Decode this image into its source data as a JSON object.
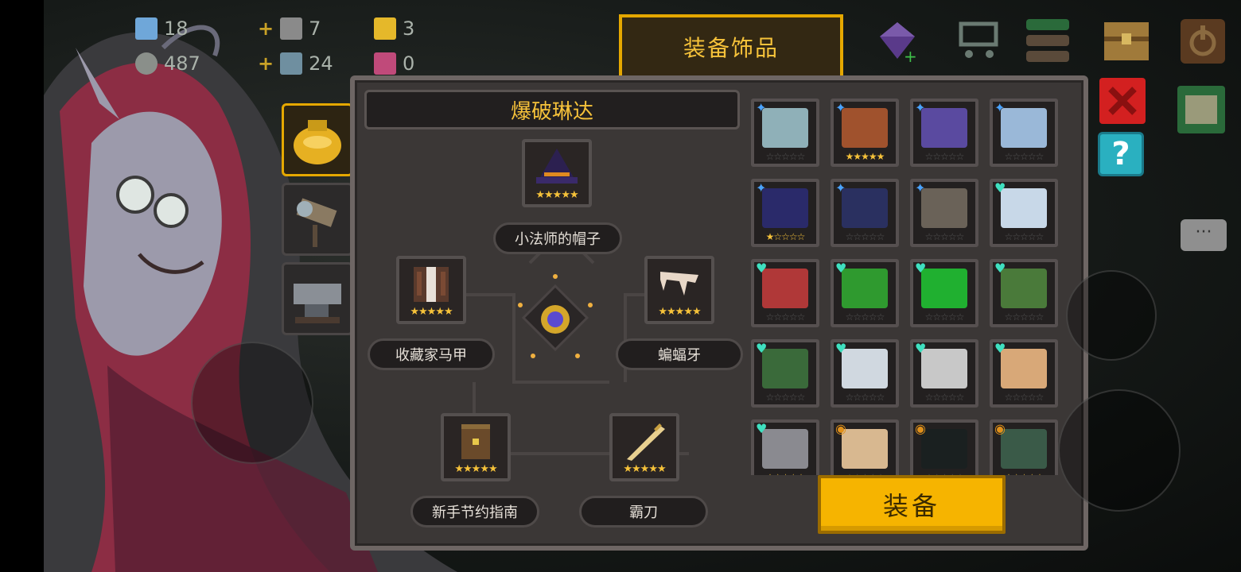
{
  "resources": [
    {
      "value": "18",
      "icon": "gem-icon",
      "color": "#6fa7d9"
    },
    {
      "value": "487",
      "icon": "coin-icon",
      "color": "#c9c9c9"
    },
    {
      "value": "7",
      "icon": "material-box-icon",
      "color": "#8a8a8a"
    },
    {
      "value": "24",
      "icon": "material-box-icon",
      "color": "#6f8fa0"
    },
    {
      "value": "3",
      "icon": "gold-key-icon",
      "color": "#e5b82a"
    },
    {
      "value": "0",
      "icon": "seed-icon",
      "color": "#c04a7a"
    }
  ],
  "title_tab": "装备饰品",
  "hero_name": "爆破琳达",
  "slots": [
    {
      "label": "小法师的帽子",
      "stars": "★★★★★",
      "icon": "wizard-hat-icon",
      "color": "#2c2050"
    },
    {
      "label": "收藏家马甲",
      "stars": "★★★★★",
      "icon": "vest-icon",
      "color": "#5a3a2c"
    },
    {
      "label": "蝙蝠牙",
      "stars": "★★★★★",
      "icon": "bat-fang-icon",
      "color": "#e8d8c8"
    },
    {
      "label": "新手节约指南",
      "stars": "★★★★★",
      "icon": "guide-book-icon",
      "color": "#6a4a2a"
    },
    {
      "label": "霸刀",
      "stars": "★★★★★",
      "icon": "saber-icon",
      "color": "#e8d090"
    }
  ],
  "grid_items": [
    {
      "icon": "lightning-shield-icon",
      "mark": "✦",
      "mark_color": "#4aa3ff",
      "stars": "☆☆☆☆☆",
      "color": "#8fb0b8"
    },
    {
      "icon": "antler-icon",
      "mark": "✦",
      "mark_color": "#4aa3ff",
      "stars": "★★★★★",
      "color": "#a0522d"
    },
    {
      "icon": "rune-shield-icon",
      "mark": "✦",
      "mark_color": "#4aa3ff",
      "stars": "☆☆☆☆☆",
      "color": "#5a4aa0"
    },
    {
      "icon": "frost-shield-icon",
      "mark": "✦",
      "mark_color": "#4aa3ff",
      "stars": "☆☆☆☆☆",
      "color": "#9ab8d8"
    },
    {
      "icon": "navy-robe-icon",
      "mark": "✦",
      "mark_color": "#4aa3ff",
      "stars": "★☆☆☆☆",
      "color": "#2a2a6a"
    },
    {
      "icon": "emblem-robe-icon",
      "mark": "✦",
      "mark_color": "#4aa3ff",
      "stars": "☆☆☆☆☆",
      "color": "#2a3060"
    },
    {
      "icon": "stone-armor-icon",
      "mark": "✦",
      "mark_color": "#4aa3ff",
      "stars": "☆☆☆☆☆",
      "color": "#6a6258"
    },
    {
      "icon": "crystal-orb-icon",
      "mark": "♥",
      "mark_color": "#3fe0c0",
      "stars": "☆☆☆☆☆",
      "color": "#c8d8e8"
    },
    {
      "icon": "meat-drumstick-icon",
      "mark": "♥",
      "mark_color": "#3fe0c0",
      "stars": "☆☆☆☆☆",
      "color": "#b03838"
    },
    {
      "icon": "green-leaf-icon",
      "mark": "♥",
      "mark_color": "#3fe0c0",
      "stars": "☆☆☆☆☆",
      "color": "#2f9a2f"
    },
    {
      "icon": "clover-icon",
      "mark": "♥",
      "mark_color": "#3fe0c0",
      "stars": "☆☆☆☆☆",
      "color": "#20b030"
    },
    {
      "icon": "sprout-icon",
      "mark": "♥",
      "mark_color": "#3fe0c0",
      "stars": "☆☆☆☆☆",
      "color": "#4a7a3a"
    },
    {
      "icon": "tank-icon",
      "mark": "♥",
      "mark_color": "#3fe0c0",
      "stars": "☆☆☆☆☆",
      "color": "#3a6a3a"
    },
    {
      "icon": "sword-feather-icon",
      "mark": "♥",
      "mark_color": "#3fe0c0",
      "stars": "☆☆☆☆☆",
      "color": "#d0d8e0"
    },
    {
      "icon": "jellyfish-icon",
      "mark": "♥",
      "mark_color": "#3fe0c0",
      "stars": "☆☆☆☆☆",
      "color": "#c8c8c8"
    },
    {
      "icon": "nerd-face-icon",
      "mark": "♥",
      "mark_color": "#3fe0c0",
      "stars": "☆☆☆☆☆",
      "color": "#d8a878"
    },
    {
      "icon": "iron-helmet-icon",
      "mark": "♥",
      "mark_color": "#3fe0c0",
      "stars": "★☆☆☆☆",
      "color": "#8a8a90"
    },
    {
      "icon": "treasure-chest-icon",
      "mark": "◉",
      "mark_color": "#e0901a",
      "stars": "☆☆☆☆☆",
      "color": "#d8b890"
    },
    {
      "icon": "dark-mask-icon",
      "mark": "◉",
      "mark_color": "#e0901a",
      "stars": "☆☆☆☆☆",
      "color": "#1a2020"
    },
    {
      "icon": "fish-cannon-icon",
      "mark": "◉",
      "mark_color": "#e0901a",
      "stars": "★☆☆☆☆",
      "color": "#3a5a48"
    }
  ],
  "equip_button": "装备",
  "help_button": "?",
  "chat_button": "···"
}
